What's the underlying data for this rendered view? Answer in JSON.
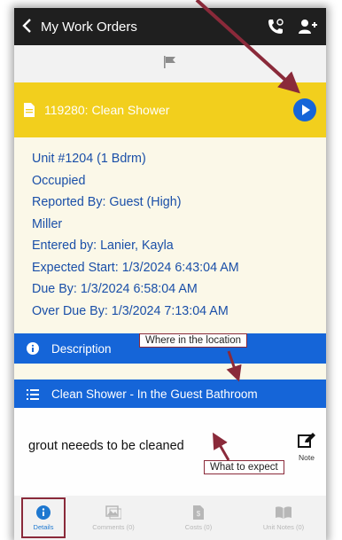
{
  "header": {
    "title": "My Work Orders",
    "back_icon": "chevron-left-icon",
    "phone_icon": "phone-icon",
    "add_user_icon": "add-user-icon"
  },
  "flag_icon": "flag-icon",
  "work_order": {
    "title": "119280: Clean Shower",
    "bar_color": "#f2cf1d",
    "play_icon": "play-icon"
  },
  "details": [
    "Unit #1204 (1 Bdrm)",
    "Occupied",
    "Reported By: Guest  (High)",
    "Miller",
    "Entered by: Lanier, Kayla",
    "Expected Start: 1/3/2024 6:43:04 AM",
    "Due By: 1/3/2024 6:58:04 AM",
    "Over Due By: 1/3/2024 7:13:04 AM"
  ],
  "description": {
    "label": "Description",
    "task": "Clean Shower - In the Guest Bathroom",
    "note_text": "grout neeeds to be cleaned",
    "note_button": "Note"
  },
  "callouts": {
    "where": "Where in the location",
    "expect": "What to expect"
  },
  "tabs": [
    {
      "label": "Details",
      "icon": "info-icon",
      "active": true
    },
    {
      "label": "Comments (0)",
      "icon": "image-icon",
      "active": false
    },
    {
      "label": "Costs (0)",
      "icon": "receipt-icon",
      "active": false
    },
    {
      "label": "Unit Notes (0)",
      "icon": "book-icon",
      "active": false
    }
  ],
  "colors": {
    "accent_blue": "#1565d8",
    "annotation": "#8a2a3a",
    "text_blue": "#1a4fa8"
  }
}
